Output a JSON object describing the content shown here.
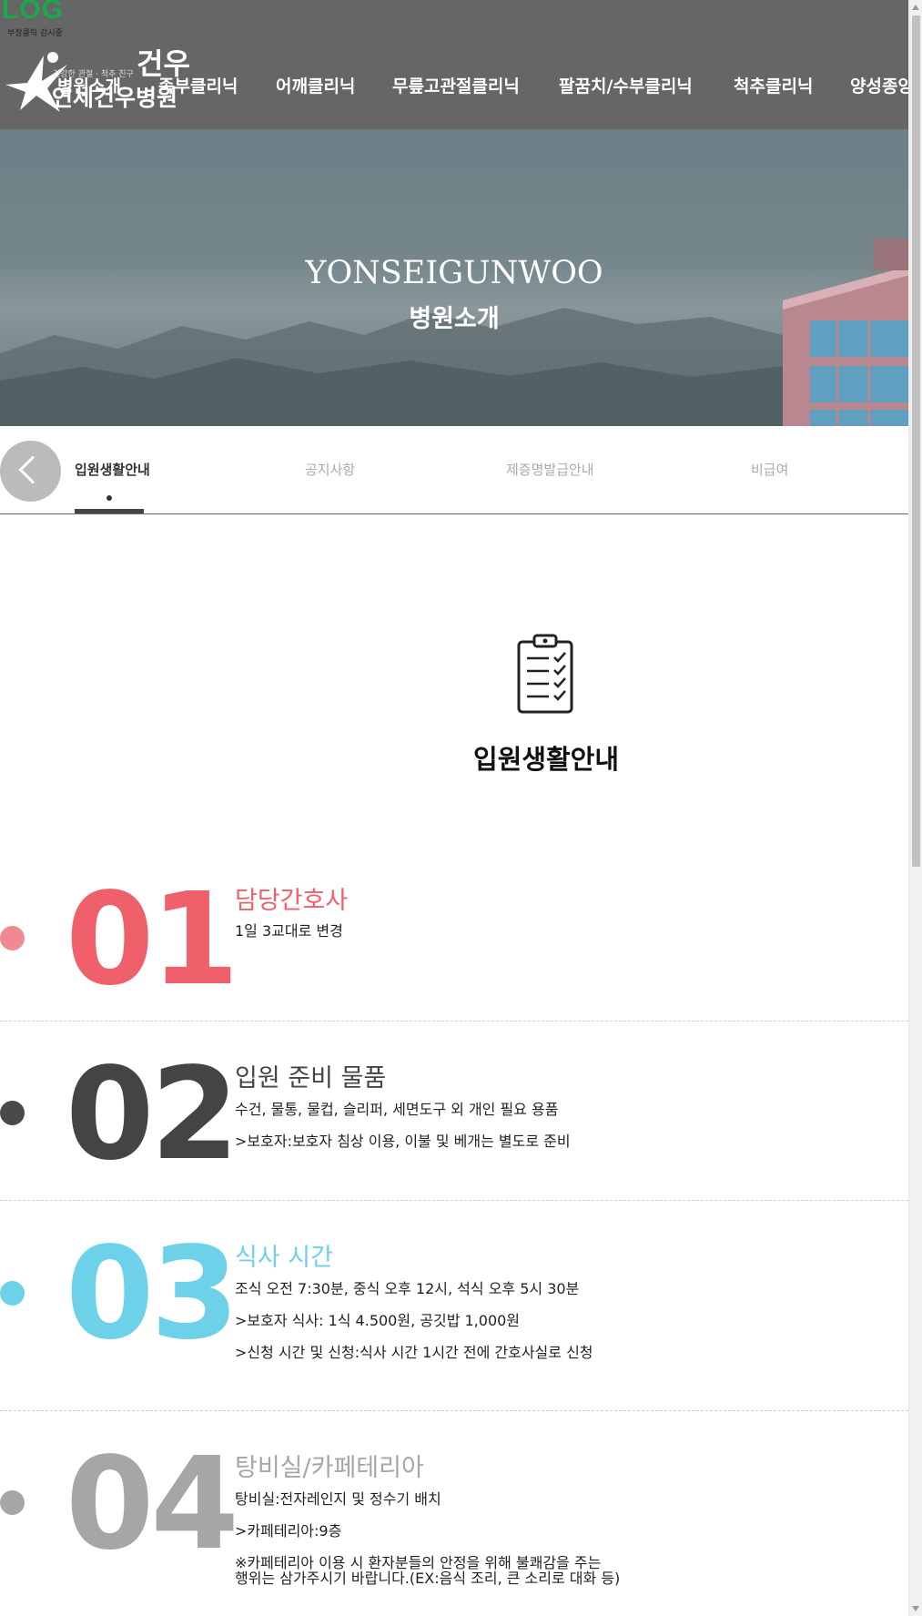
{
  "badge": {
    "logo_text": "LOG",
    "caption": "부정클릭 감시중"
  },
  "logo": {
    "hanja_mark": "건우",
    "slogan": "건강한 관절 · 척추 친구",
    "name": "연세건우병원"
  },
  "nav": [
    "병원소개",
    "족부클리닉",
    "어깨클리닉",
    "무릎고관절클리닉",
    "팔꿈치/수부클리닉",
    "척추클리닉",
    "양성종양"
  ],
  "hero": {
    "title": "YONSEIGUNWOO",
    "subtitle": "병원소개"
  },
  "subnav": {
    "back_icon": "chevron-left-icon",
    "tabs": [
      {
        "label": "입원생활안내",
        "active": true
      },
      {
        "label": "공지사항",
        "active": false
      },
      {
        "label": "제증명발급안내",
        "active": false
      },
      {
        "label": "비급여",
        "active": false
      }
    ]
  },
  "section": {
    "icon": "clipboard-checklist-icon",
    "title": "입원생활안내"
  },
  "items": [
    {
      "number": "01",
      "color": "#f0606a",
      "bullet_color": "#f08a92",
      "title": "담당간호사",
      "lines": [
        "1일 3교대로 변경"
      ]
    },
    {
      "number": "02",
      "color": "#444444",
      "bullet_color": "#4a4a4a",
      "title": "입원 준비 물품",
      "lines": [
        "수건, 물통, 물컵, 슬리퍼, 세면도구 외 개인 필요 용품",
        ">보호자:보호자 침상 이용, 이불 및 베개는 별도로 준비"
      ]
    },
    {
      "number": "03",
      "color": "#6ed1ea",
      "bullet_color": "#6ed1ea",
      "title": "식사 시간",
      "lines": [
        "조식 오전 7:30분, 중식 오후 12시, 석식 오후 5시 30분",
        ">보호자 식사: 1식 4.500원, 공깃밥 1,000원",
        ">신청 시간 및 신청:식사 시간 1시간 전에 간호사실로 신청"
      ]
    },
    {
      "number": "04",
      "color": "#a6a6a6",
      "bullet_color": "#a6a6a6",
      "title": "탕비실/카페테리아",
      "lines": [
        "탕비실:전자레인지 및 정수기 배치",
        ">카페테리아:9층",
        "※카페테리아 이용 시 환자분들의 안정을 위해 불쾌감을 주는",
        "행위는 삼가주시기 바랍니다.(EX:음식 조리, 큰 소리로 대화 등)"
      ]
    }
  ]
}
